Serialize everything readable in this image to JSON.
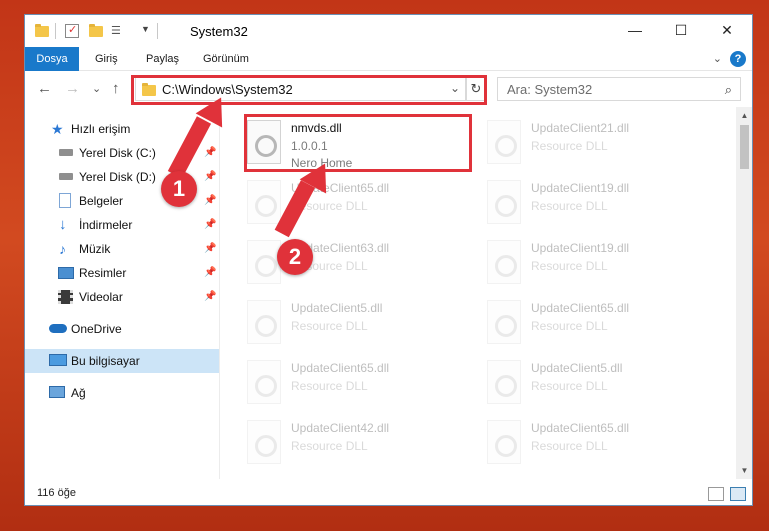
{
  "window": {
    "title": "System32",
    "controls": {
      "minimize": "—",
      "maximize": "☐",
      "close": "✕"
    }
  },
  "ribbon": {
    "tabs": [
      "Dosya",
      "Giriş",
      "Paylaş",
      "Görünüm"
    ],
    "help": "?"
  },
  "nav": {
    "back": "←",
    "forward": "→",
    "recent": "⌄",
    "up": "↑",
    "address": "C:\\Windows\\System32",
    "address_dropdown": "⌄",
    "refresh": "↻",
    "search_placeholder": "Ara: System32",
    "search_icon": "⌕"
  },
  "sidebar": {
    "items": [
      {
        "label": "Hızlı erişim",
        "icon": "star-icon"
      },
      {
        "label": "Yerel Disk (C:)",
        "icon": "drive-icon",
        "pinned": true
      },
      {
        "label": "Yerel Disk (D:)",
        "icon": "drive-icon",
        "pinned": true
      },
      {
        "label": "Belgeler",
        "icon": "documents-icon",
        "pinned": true
      },
      {
        "label": "İndirmeler",
        "icon": "download-icon",
        "pinned": true
      },
      {
        "label": "Müzik",
        "icon": "music-icon",
        "pinned": true
      },
      {
        "label": "Resimler",
        "icon": "pictures-icon",
        "pinned": true
      },
      {
        "label": "Videolar",
        "icon": "videos-icon",
        "pinned": true
      },
      {
        "label": "OneDrive",
        "icon": "cloud-icon"
      },
      {
        "label": "Bu bilgisayar",
        "icon": "computer-icon",
        "selected": true
      },
      {
        "label": "Ağ",
        "icon": "network-icon"
      }
    ]
  },
  "content": {
    "items": [
      {
        "name": "nmvds.dll",
        "line1": "1.0.0.1",
        "line2": "Nero Home",
        "highlight": true
      },
      {
        "name": "UpdateClient21.dll",
        "line1": "Resource DLL"
      },
      {
        "name": "UpdateClient65.dll",
        "line1": "Resource DLL"
      },
      {
        "name": "UpdateClient19.dll",
        "line1": "Resource DLL"
      },
      {
        "name": "UpdateClient63.dll",
        "line1": "Resource DLL"
      },
      {
        "name": "UpdateClient19.dll",
        "line1": "Resource DLL"
      },
      {
        "name": "UpdateClient5.dll",
        "line1": "Resource DLL"
      },
      {
        "name": "UpdateClient65.dll",
        "line1": "Resource DLL"
      },
      {
        "name": "UpdateClient65.dll",
        "line1": "Resource DLL"
      },
      {
        "name": "UpdateClient5.dll",
        "line1": "Resource DLL"
      },
      {
        "name": "UpdateClient42.dll",
        "line1": "Resource DLL"
      },
      {
        "name": "UpdateClient65.dll",
        "line1": "Resource DLL"
      }
    ]
  },
  "status": {
    "count": "116 öğe"
  },
  "annotations": {
    "step1": "1",
    "step2": "2",
    "accent_color": "#e0323a"
  },
  "colors": {
    "ribbon_file_tab": "#1979ca",
    "selected_nav": "#cce4f7"
  }
}
